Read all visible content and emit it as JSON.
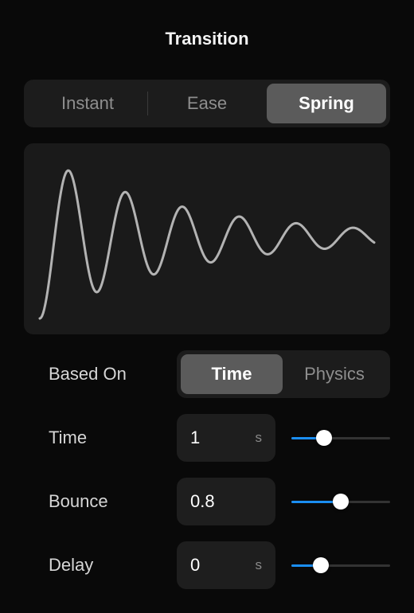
{
  "panel": {
    "title": "Transition"
  },
  "transition_type": {
    "options": [
      "Instant",
      "Ease",
      "Spring"
    ],
    "selected": "Spring"
  },
  "curve_preview": {
    "icon": "spring-curve",
    "stroke_color": "#b3b3b3"
  },
  "based_on": {
    "label": "Based On",
    "options": [
      "Time",
      "Physics"
    ],
    "selected": "Time"
  },
  "time": {
    "label": "Time",
    "value": "1",
    "unit": "s",
    "slider_fraction": 0.33
  },
  "bounce": {
    "label": "Bounce",
    "value": "0.8",
    "unit": "",
    "slider_fraction": 0.5
  },
  "delay": {
    "label": "Delay",
    "value": "0",
    "unit": "s",
    "slider_fraction": 0.3
  },
  "colors": {
    "accent": "#1b8ef2",
    "background": "#090909",
    "surface": "#1c1c1c",
    "selected_segment": "#5b5b5b"
  }
}
